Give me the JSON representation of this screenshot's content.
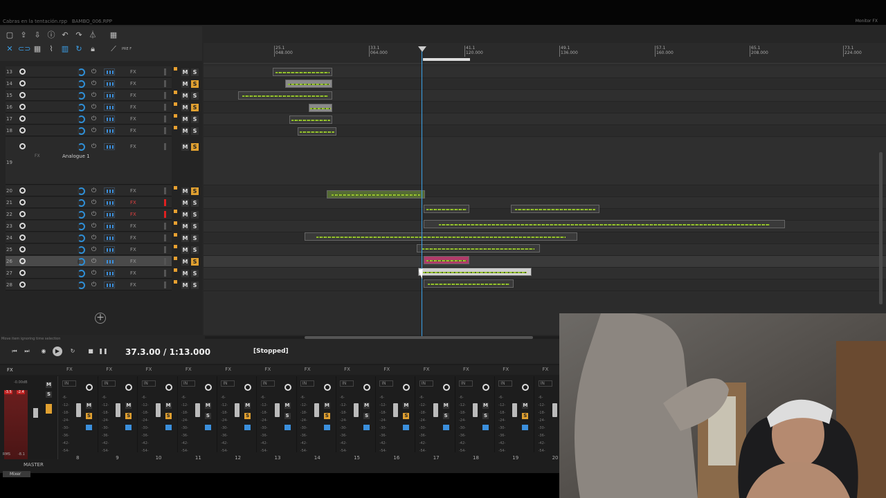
{
  "window": {
    "title": "Cabras en la tentación.rpp",
    "tab2": "BAMBO_006.RPP",
    "right": "Monitor FX"
  },
  "toolbar": {
    "pre_label": "PRE F"
  },
  "ruler": {
    "markers": [
      {
        "top": "25.1",
        "bottom": "048.000"
      },
      {
        "top": "33.1",
        "bottom": "064.000"
      },
      {
        "top": "41.1",
        "bottom": "120.000"
      },
      {
        "top": "49.1",
        "bottom": "136.000"
      },
      {
        "top": "57.1",
        "bottom": "160.000"
      },
      {
        "top": "65.1",
        "bottom": "208.000"
      },
      {
        "top": "73.1",
        "bottom": "224.000"
      }
    ]
  },
  "tracks": [
    {
      "num": "13",
      "fx": "FX",
      "solo": false,
      "env": true
    },
    {
      "num": "14",
      "fx": "FX",
      "solo": true,
      "env": false
    },
    {
      "num": "15",
      "fx": "FX",
      "solo": false,
      "env": true
    },
    {
      "num": "16",
      "fx": "FX",
      "solo": true,
      "env": true
    },
    {
      "num": "17",
      "fx": "FX",
      "solo": false,
      "env": true
    },
    {
      "num": "18",
      "fx": "FX",
      "solo": false,
      "env": true
    },
    {
      "num": "19",
      "fx": "FX",
      "solo": true,
      "env": false
    },
    {
      "num": "20",
      "fx": "FX",
      "solo": true,
      "env": true
    },
    {
      "num": "21",
      "fx": "FX",
      "solo": false,
      "env": false,
      "red": true
    },
    {
      "num": "22",
      "fx": "FX",
      "solo": false,
      "env": true,
      "red": true
    },
    {
      "num": "23",
      "fx": "FX",
      "solo": false,
      "env": true
    },
    {
      "num": "24",
      "fx": "FX",
      "solo": false,
      "env": true
    },
    {
      "num": "25",
      "fx": "FX",
      "solo": false,
      "env": true
    },
    {
      "num": "26",
      "fx": "FX",
      "solo": true,
      "env": true
    },
    {
      "num": "27",
      "fx": "FX",
      "solo": false,
      "env": true
    },
    {
      "num": "28",
      "fx": "FX",
      "solo": false,
      "env": true
    }
  ],
  "track19_plugin": {
    "fx": "FX",
    "name": "Analogue 1"
  },
  "mute_label": "M",
  "solo_label": "S",
  "status": {
    "left": "Move item ignoring time selection"
  },
  "transport": {
    "time": "37.3.00 / 1:13.000",
    "state": "[Stopped]"
  },
  "mixer": {
    "master_label": "MASTER",
    "master_db": "-0.00dB",
    "master_rms": "RMS",
    "master_rms_val": "-8.1",
    "master_peak_l": "-3.5",
    "master_peak_r": "-2.4",
    "tab_label": "Mixer",
    "strip_numbers": [
      "8",
      "9",
      "10",
      "11",
      "12",
      "13",
      "14",
      "15",
      "16",
      "17",
      "18",
      "19",
      "20"
    ],
    "strip_solo": [
      true,
      true,
      true,
      false,
      true,
      false,
      true,
      false,
      true,
      false,
      false,
      true,
      false
    ],
    "in_label": "IN",
    "fx_label": "FX",
    "scale": [
      "-6-",
      "-12-",
      "-18-",
      "-24-",
      "-30-",
      "-36-",
      "-42-",
      "-54-"
    ]
  }
}
